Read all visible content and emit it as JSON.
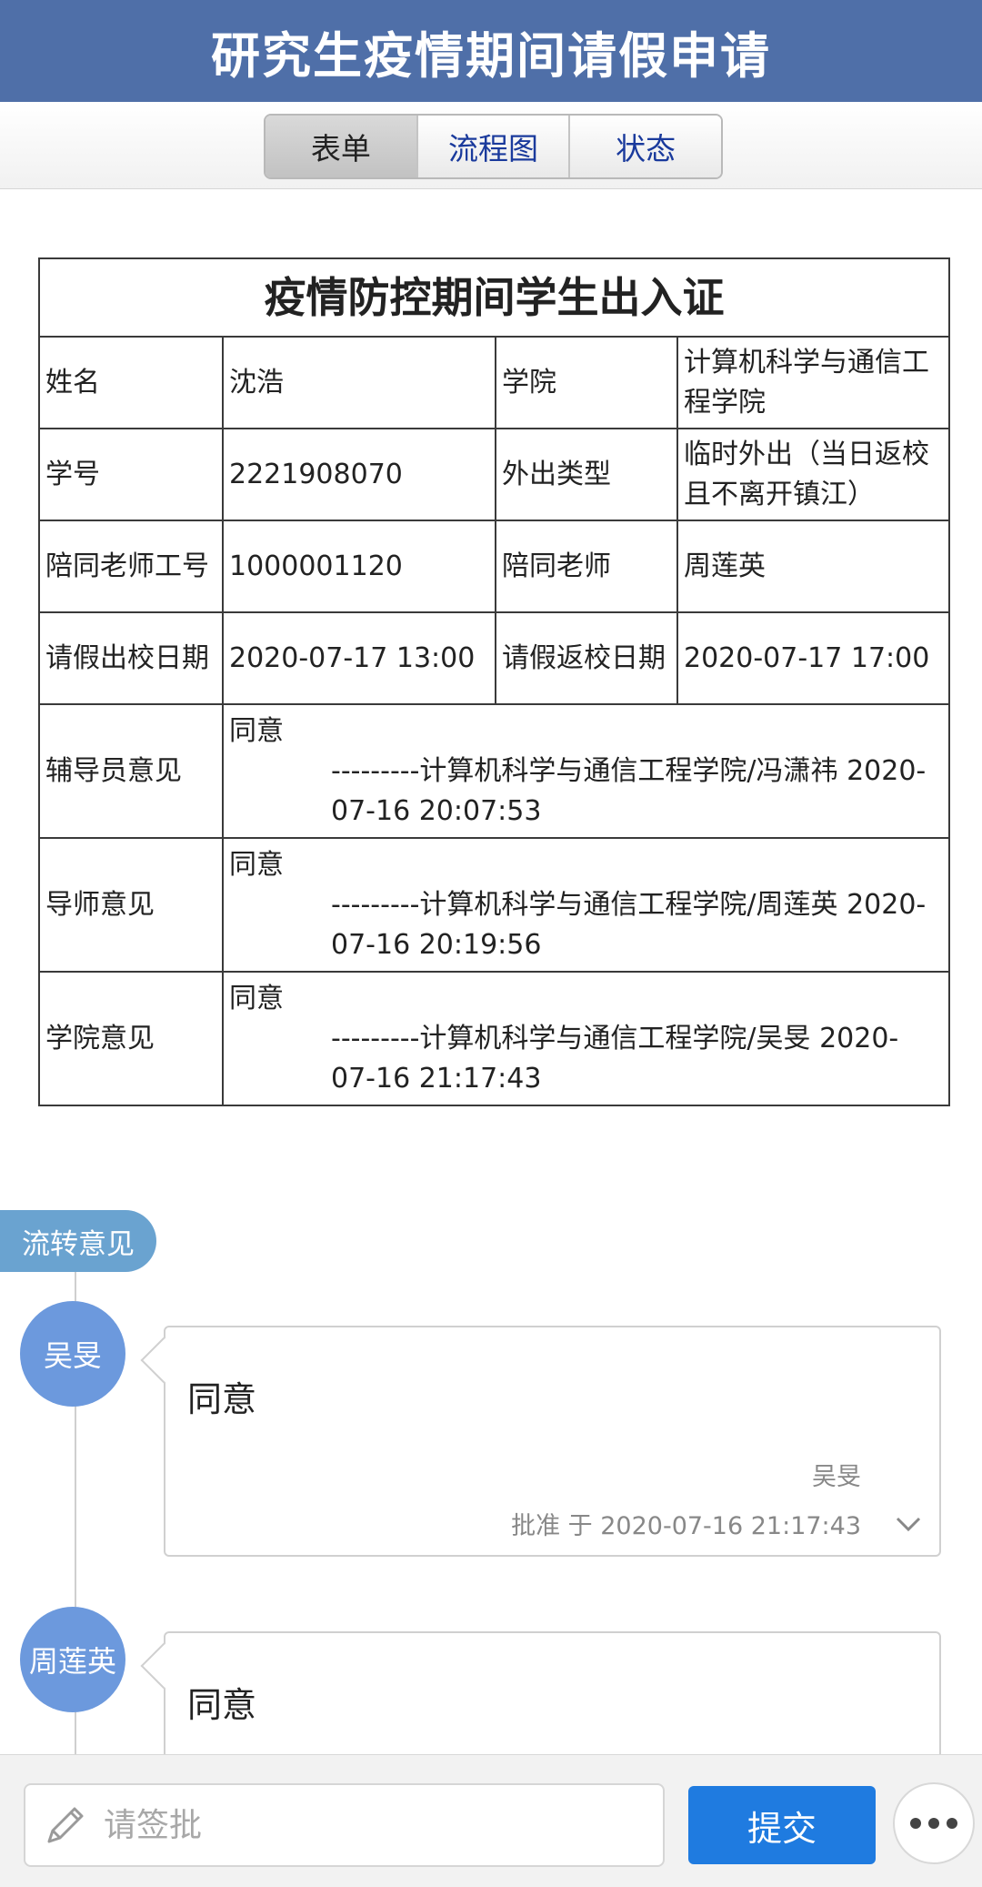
{
  "header": {
    "title": "研究生疫情期间请假申请"
  },
  "tabs": [
    {
      "label": "表单",
      "active": true
    },
    {
      "label": "流程图",
      "active": false
    },
    {
      "label": "状态",
      "active": false
    }
  ],
  "form": {
    "title": "疫情防控期间学生出入证",
    "rows": [
      {
        "l1": "姓名",
        "v1": "沈浩",
        "l2": "学院",
        "v2": "计算机科学与通信工程学院"
      },
      {
        "l1": "学号",
        "v1": "2221908070",
        "l2": "外出类型",
        "v2": "临时外出（当日返校且不离开镇江）"
      },
      {
        "l1": "陪同老师工号",
        "v1": "1000001120",
        "l2": "陪同老师",
        "v2": "周莲英"
      },
      {
        "l1": "请假出校日期",
        "v1": "2020-07-17 13:00",
        "l2": "请假返校日期",
        "v2": "2020-07-17 17:00"
      }
    ],
    "opinions": [
      {
        "label": "辅导员意见",
        "text": "同意",
        "signature": "---------计算机科学与通信工程学院/冯潇祎 2020-07-16 20:07:53"
      },
      {
        "label": "导师意见",
        "text": "同意",
        "signature": "---------计算机科学与通信工程学院/周莲英 2020-07-16 20:19:56"
      },
      {
        "label": "学院意见",
        "text": "同意",
        "signature": "---------计算机科学与通信工程学院/吴旻 2020-07-16 21:17:43"
      }
    ]
  },
  "flow": {
    "badge": "流转意见",
    "items": [
      {
        "avatar": "吴旻",
        "comment": "同意",
        "user": "吴旻",
        "time": "批准 于 2020-07-16 21:17:43"
      },
      {
        "avatar": "周莲英",
        "comment": "同意"
      }
    ]
  },
  "bottom": {
    "placeholder": "请签批",
    "submit": "提交"
  },
  "icons": {
    "pen": "pen-icon",
    "more": "more-icon",
    "chevron": "chevron-down-icon"
  },
  "colors": {
    "header": "#4f6fa8",
    "avatar": "#6c99dd",
    "badge": "#6aa3d0",
    "submit": "#1f7be0"
  }
}
